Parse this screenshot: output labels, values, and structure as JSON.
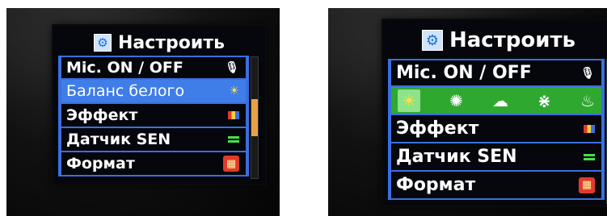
{
  "left_screen": {
    "title": "Настроить",
    "gear_icon": "⚙",
    "menu": [
      {
        "label": "Mic. ON / OFF",
        "icon": "microphone-icon",
        "glyph": "🎙"
      },
      {
        "label": "Баланс белого",
        "icon": "white-balance-icon",
        "glyph": "☀"
      },
      {
        "label": "Эффект",
        "icon": "effect-icon",
        "glyph": ""
      },
      {
        "label": "Датчик SEN",
        "icon": "sensor-icon",
        "glyph": ""
      },
      {
        "label": "Формат",
        "icon": "format-icon",
        "glyph": "▦"
      }
    ],
    "selected_index": 1
  },
  "right_screen": {
    "title": "Настроить",
    "gear_icon": "⚙",
    "menu": [
      {
        "label": "Mic. ON / OFF",
        "icon": "microphone-icon",
        "glyph": "🎙"
      },
      {
        "label": "Эффект",
        "icon": "effect-icon",
        "glyph": ""
      },
      {
        "label": "Датчик SEN",
        "icon": "sensor-icon",
        "glyph": ""
      },
      {
        "label": "Формат",
        "icon": "format-icon",
        "glyph": "▦"
      }
    ],
    "white_balance_options": [
      {
        "name": "auto-wb-icon",
        "glyph": "☀",
        "active": true
      },
      {
        "name": "daylight-icon",
        "glyph": "✺",
        "active": false
      },
      {
        "name": "cloudy-icon",
        "glyph": "☁",
        "active": false
      },
      {
        "name": "fluorescent-icon",
        "glyph": "⋇",
        "active": false
      },
      {
        "name": "incandescent-icon",
        "glyph": "♨",
        "active": false
      }
    ]
  },
  "colors": {
    "menu_border": "#3a6fe0",
    "selection": "#3f7de8",
    "wb_row": "#2fa830",
    "scroll_thumb": "#e5a246"
  }
}
